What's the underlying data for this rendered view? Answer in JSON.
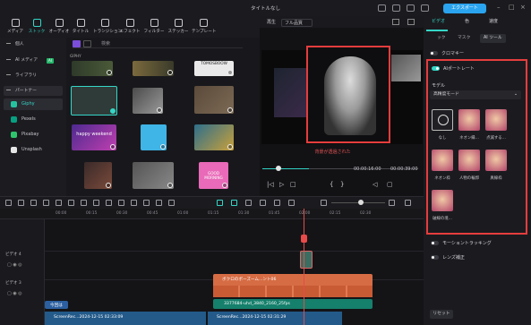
{
  "window": {
    "title": "タイトルなし",
    "export_label": "エクスポート"
  },
  "toolbar": {
    "items": [
      {
        "label": "メディア"
      },
      {
        "label": "ストック"
      },
      {
        "label": "オーディオ"
      },
      {
        "label": "タイトル"
      },
      {
        "label": "トランジション"
      },
      {
        "label": "エフェクト"
      },
      {
        "label": "フィルター"
      },
      {
        "label": "ステッカー"
      },
      {
        "label": "テンプレート"
      }
    ]
  },
  "sidebar": {
    "items": [
      {
        "label": "個人"
      },
      {
        "label": "AI メディア"
      },
      {
        "label": "ライブラリ"
      },
      {
        "label": "パートナー"
      }
    ],
    "ai_badge": "AI",
    "partners": [
      {
        "label": "Giphy"
      },
      {
        "label": "Pexels"
      },
      {
        "label": "Pixabay"
      },
      {
        "label": "Unsplash"
      }
    ]
  },
  "library": {
    "search_placeholder": "検索",
    "section_label": "GIPHY",
    "thumb_texts": [
      "TOMOSBOOW",
      "happy weekend",
      "GOOD MORNING"
    ]
  },
  "preview": {
    "tab_player": "再生",
    "quality": "フル品質",
    "caption": "背景が透過された",
    "time_current": "00:00:16:00",
    "time_total": "00:00:39:00"
  },
  "right_panel": {
    "tabs": [
      {
        "label": "ビデオ"
      },
      {
        "label": "色"
      },
      {
        "label": "速度"
      }
    ],
    "subtabs": [
      {
        "label": "ック"
      },
      {
        "label": "マスク"
      },
      {
        "label": "AI ツール"
      }
    ],
    "chroma_key": "クロマキー",
    "ai_portrait": "AIポートレート",
    "model_label": "モデル",
    "model_value": "高精度モード",
    "effects": [
      {
        "label": "なし"
      },
      {
        "label": "ネオン縁..."
      },
      {
        "label": "点滅する..."
      },
      {
        "label": "ネオン枠"
      },
      {
        "label": "人物の輪郭"
      },
      {
        "label": "真線枠"
      },
      {
        "label": "破線の境..."
      }
    ],
    "motion_tracking": "モーショントラッキング",
    "lens_correction": "レンズ補正",
    "reset_label": "リセット"
  },
  "timeline": {
    "ruler": [
      "00:00",
      "00:15",
      "00:30",
      "00:45",
      "01:00",
      "01:15",
      "01:30",
      "01:45",
      "02:00",
      "02:15",
      "02:30"
    ],
    "tracks": [
      {
        "label": "ビデオ 4"
      },
      {
        "label": "ビデオ 3"
      }
    ],
    "clip_orange": "ボクロのポーズーム...ント06",
    "clip_green": "3377684-uhd_3840_2160_25fps",
    "clip_bottom_a": "ScreenRec...2024-12-15 02:33:09",
    "clip_bottom_b": "ScreenRec...2024-12-15 02:31:29",
    "clip_bottom_c": "今回は"
  },
  "colors": {
    "accent": "#35d6c6",
    "highlight": "#e53d3d",
    "export": "#2aa4ee"
  }
}
